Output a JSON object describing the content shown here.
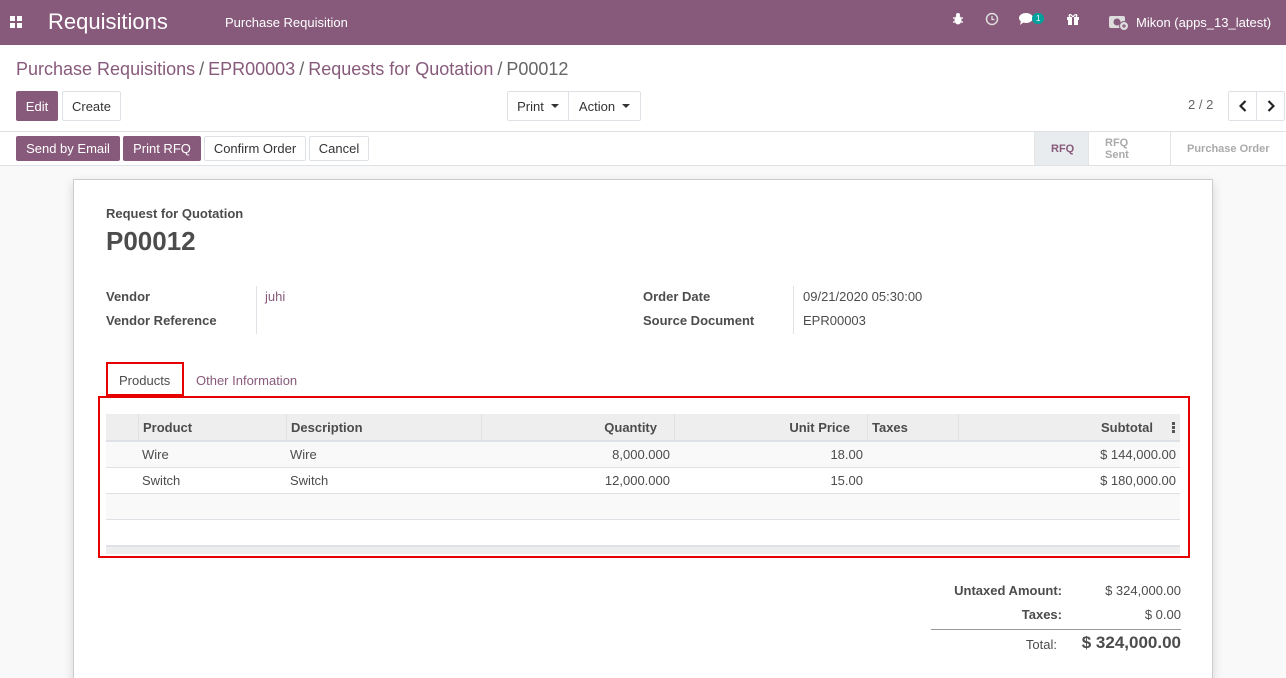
{
  "topbar": {
    "app_title": "Requisitions",
    "menu_item": "Purchase Requisition",
    "chat_badge": "1",
    "user_name": "Mikon (apps_13_latest)",
    "color": "#875a7b"
  },
  "breadcrumb": {
    "items": [
      "Purchase Requisitions",
      "EPR00003",
      "Requests for Quotation"
    ],
    "current": "P00012",
    "separator": "/"
  },
  "toolbar": {
    "edit_label": "Edit",
    "create_label": "Create",
    "print_label": "Print",
    "action_label": "Action",
    "pager": "2 / 2"
  },
  "statusbar": {
    "buttons": {
      "send_email": "Send by Email",
      "print_rfq": "Print RFQ",
      "confirm": "Confirm Order",
      "cancel": "Cancel"
    },
    "steps": [
      "RFQ",
      "RFQ Sent",
      "Purchase Order"
    ],
    "active_step": "RFQ"
  },
  "form": {
    "subtitle": "Request for Quotation",
    "title": "P00012",
    "fields": {
      "vendor_label": "Vendor",
      "vendor_value": "juhi",
      "vendor_ref_label": "Vendor Reference",
      "vendor_ref_value": "",
      "order_date_label": "Order Date",
      "order_date_value": "09/21/2020 05:30:00",
      "source_doc_label": "Source Document",
      "source_doc_value": "EPR00003"
    },
    "tabs": [
      "Products",
      "Other Information"
    ],
    "active_tab": "Products"
  },
  "lines": {
    "columns": [
      "Product",
      "Description",
      "Quantity",
      "Unit Price",
      "Taxes",
      "Subtotal"
    ],
    "rows": [
      {
        "product": "Wire",
        "description": "Wire",
        "quantity": "8,000.000",
        "unit_price": "18.00",
        "taxes": "",
        "subtotal": "$ 144,000.00"
      },
      {
        "product": "Switch",
        "description": "Switch",
        "quantity": "12,000.000",
        "unit_price": "15.00",
        "taxes": "",
        "subtotal": "$ 180,000.00"
      }
    ]
  },
  "totals": {
    "untaxed_label": "Untaxed Amount:",
    "untaxed_value": "$ 324,000.00",
    "taxes_label": "Taxes:",
    "taxes_value": "$ 0.00",
    "total_label": "Total:",
    "total_value": "$ 324,000.00"
  },
  "highlight_color": "#e60000"
}
